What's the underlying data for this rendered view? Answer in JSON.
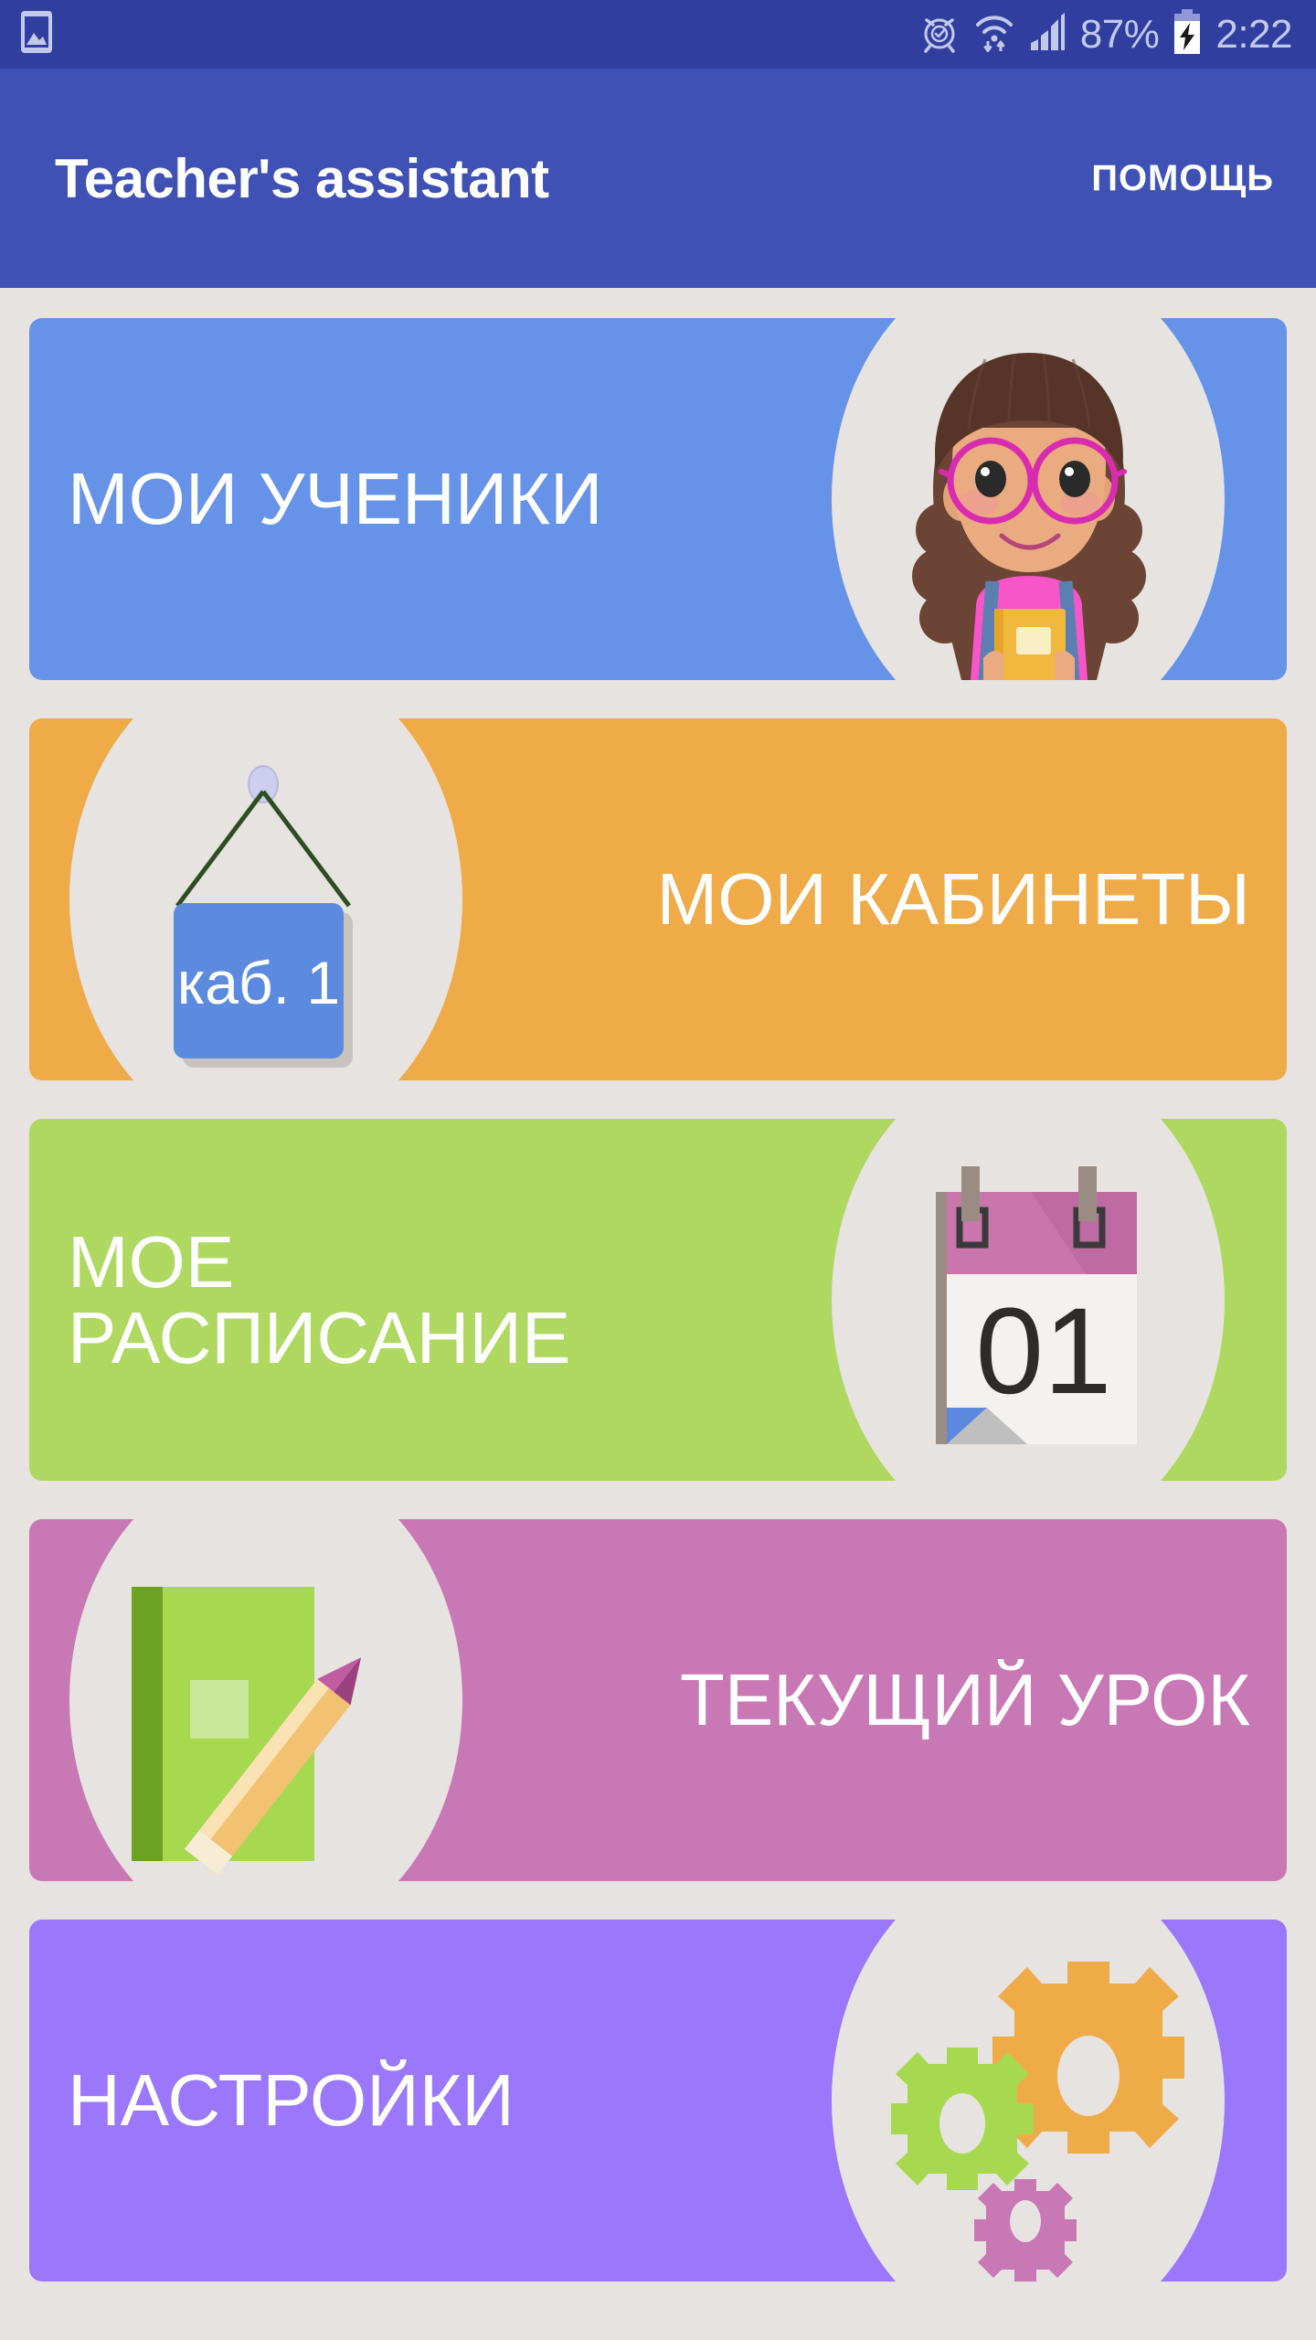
{
  "status_bar": {
    "background": "#303f9f",
    "left_icons": [
      "image-gallery-icon"
    ],
    "right_icons": [
      "alarm-clock-icon",
      "wifi-icon",
      "signal-bars-icon",
      "battery-charging-icon"
    ],
    "battery_percent": "87%",
    "clock": "2:22"
  },
  "app_bar": {
    "background": "#3f51b5",
    "title": "Teacher's assistant",
    "action_label": "ПОМОЩЬ"
  },
  "cards": [
    {
      "id": "my-students",
      "label": "МОИ УЧЕНИКИ",
      "color": "#6693e8",
      "align": "left",
      "icon": "student-girl-icon"
    },
    {
      "id": "my-classrooms",
      "label": "МОИ КАБИНЕТЫ",
      "color": "#eeab47",
      "align": "right",
      "icon": "hanging-sign-icon",
      "sign_text": "каб. 1"
    },
    {
      "id": "my-schedule",
      "label": "МОЕ\nРАСПИСАНИЕ",
      "color": "#aed860",
      "align": "left",
      "icon": "calendar-icon",
      "calendar_day": "01"
    },
    {
      "id": "current-lesson",
      "label": "ТЕКУЩИЙ УРОК",
      "color": "#c878b4",
      "align": "right",
      "icon": "book-pencil-icon"
    },
    {
      "id": "settings",
      "label": "НАСТРОЙКИ",
      "color": "#9b77fb",
      "align": "left",
      "icon": "gears-icon"
    }
  ],
  "palette": {
    "page_background": "#e7e3e1",
    "blob": "#e7e3e1",
    "text_on_card": "#ffffff"
  }
}
